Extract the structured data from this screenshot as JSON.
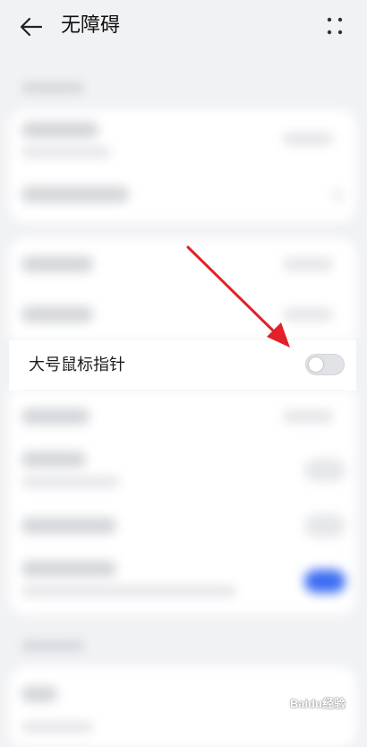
{
  "header": {
    "title": "无障碍",
    "back_icon": "arrow-left-icon",
    "more_icon": "more-dots-icon"
  },
  "focused_item": {
    "label": "大号鼠标指针",
    "toggle_on": false
  },
  "colors": {
    "background": "#f1f2f4",
    "card": "#ffffff",
    "accent": "#3d6df2",
    "annotation_arrow": "#e3202a"
  },
  "watermark": {
    "text": "Baidu经验"
  }
}
